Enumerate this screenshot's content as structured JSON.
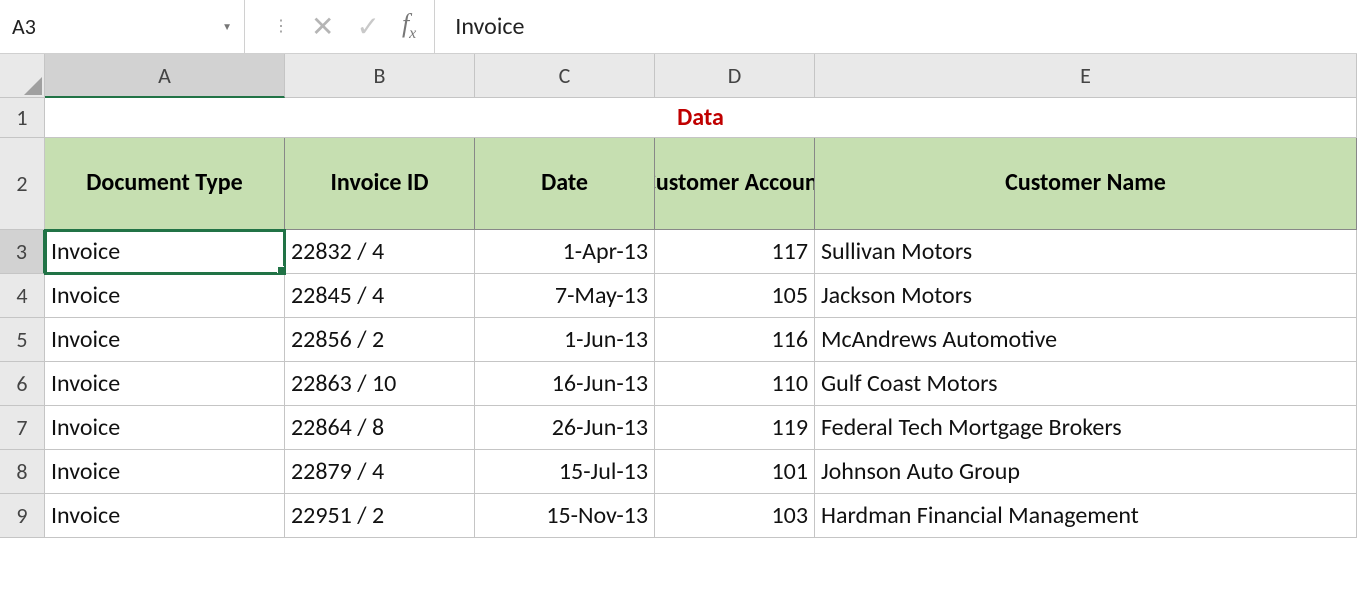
{
  "formula_bar": {
    "name_box": "A3",
    "formula_value": "Invoice"
  },
  "columns": [
    "A",
    "B",
    "C",
    "D",
    "E"
  ],
  "active_column_index": 0,
  "active_row": 3,
  "title_row": {
    "row_num": "1",
    "text": "Data"
  },
  "header_row": {
    "row_num": "2",
    "cells": {
      "A": "Document Type",
      "B": "Invoice ID",
      "C": "Date",
      "D": "Customer Account",
      "E": "Customer Name"
    }
  },
  "data_rows": [
    {
      "row_num": "3",
      "A": "Invoice",
      "B": "22832 / 4",
      "C": "1-Apr-13",
      "D": "117",
      "E": "Sullivan Motors"
    },
    {
      "row_num": "4",
      "A": "Invoice",
      "B": "22845 / 4",
      "C": "7-May-13",
      "D": "105",
      "E": "Jackson Motors"
    },
    {
      "row_num": "5",
      "A": "Invoice",
      "B": "22856 / 2",
      "C": "1-Jun-13",
      "D": "116",
      "E": "McAndrews Automotive"
    },
    {
      "row_num": "6",
      "A": "Invoice",
      "B": "22863 / 10",
      "C": "16-Jun-13",
      "D": "110",
      "E": "Gulf Coast Motors"
    },
    {
      "row_num": "7",
      "A": "Invoice",
      "B": "22864 / 8",
      "C": "26-Jun-13",
      "D": "119",
      "E": "Federal Tech Mortgage Brokers"
    },
    {
      "row_num": "8",
      "A": "Invoice",
      "B": "22879 / 4",
      "C": "15-Jul-13",
      "D": "101",
      "E": "Johnson Auto Group"
    },
    {
      "row_num": "9",
      "A": "Invoice",
      "B": "22951 / 2",
      "C": "15-Nov-13",
      "D": "103",
      "E": "Hardman Financial Management"
    }
  ]
}
